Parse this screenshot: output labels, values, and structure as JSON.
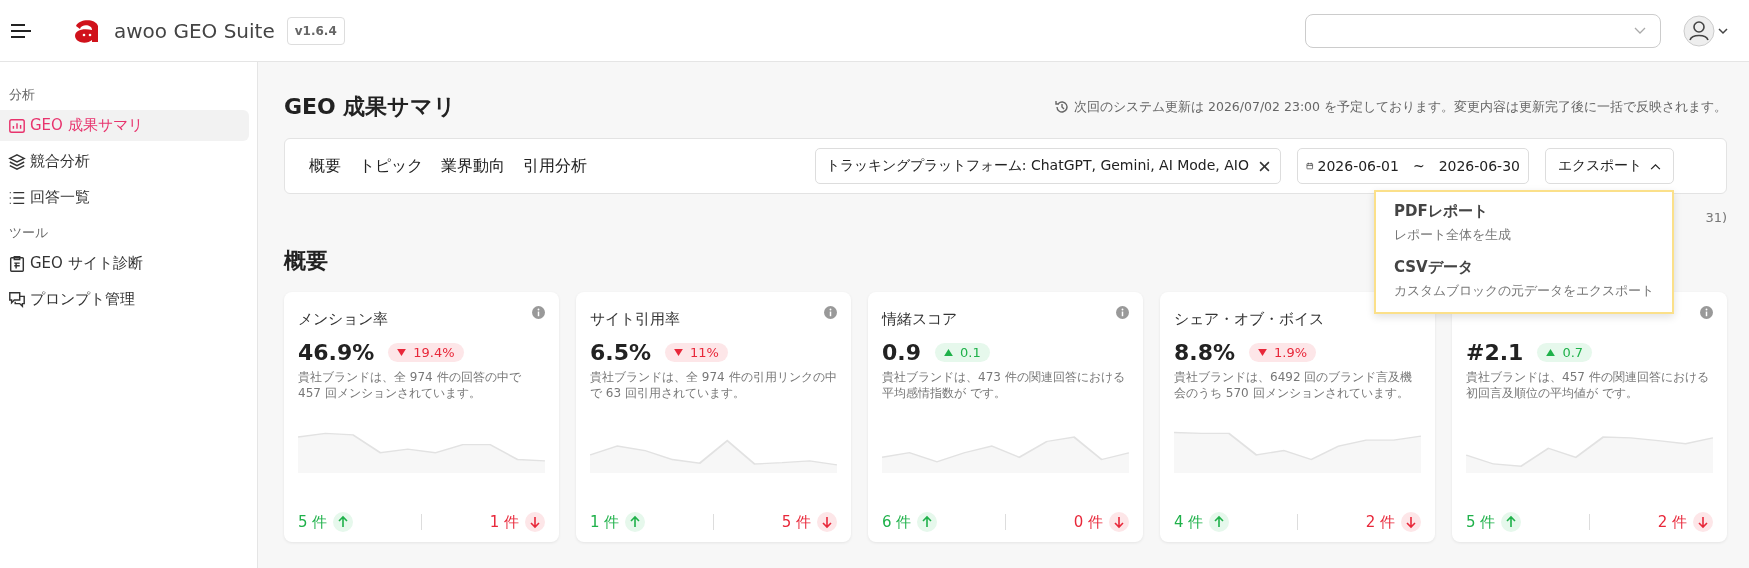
{
  "header": {
    "app_name": "awoo GEO Suite",
    "version": "v1.6.4",
    "select": {
      "open": false
    }
  },
  "sidebar": {
    "sections": [
      {
        "label": "分析",
        "items": [
          {
            "label": "GEO 成果サマリ",
            "selected": true
          },
          {
            "label": "競合分析",
            "selected": false
          },
          {
            "label": "回答一覧",
            "selected": false
          }
        ]
      },
      {
        "label": "ツール",
        "items": [
          {
            "label": "GEO サイト診断",
            "selected": false
          },
          {
            "label": "プロンプト管理",
            "selected": false
          }
        ]
      }
    ]
  },
  "page": {
    "title": "GEO 成果サマリ",
    "notice": "次回のシステム更新は 2026/07/02 23:00 を予定しております。変更内容は更新完了後に一括で反映されます。"
  },
  "tabs": [
    {
      "label": "概要"
    },
    {
      "label": "トピック"
    },
    {
      "label": "業界動向"
    },
    {
      "label": "引用分析"
    }
  ],
  "filter": {
    "value": "トラッキングプラットフォーム: ChatGPT, Gemini, AI Mode, AIO"
  },
  "date_range": {
    "start": "2026-06-01",
    "separator": "~",
    "end": "2026-06-30"
  },
  "export": {
    "label": "エクスポート",
    "expanded": true,
    "menu": [
      {
        "title": "PDFレポート",
        "description": "レポート全体を生成"
      },
      {
        "title": "CSVデータ",
        "description": "カスタムブロックの元データをエクスポート"
      }
    ]
  },
  "period_note": "31)",
  "section_title": "概要",
  "cards": [
    {
      "title": "メンション率",
      "value": "46.9%",
      "delta": "19.4%",
      "kind": "down",
      "info": true,
      "description": "貴社ブランドは、全 974 件の回答の中で 457 回メンションされています。",
      "up_count": "5 件",
      "down_count": "1 件"
    },
    {
      "title": "サイト引用率",
      "value": "6.5%",
      "delta": "11%",
      "kind": "down",
      "info": true,
      "description": "貴社ブランドは、全 974 件の引用リンクの中で 63 回引用されています。",
      "up_count": "1 件",
      "down_count": "5 件"
    },
    {
      "title": "情緒スコア",
      "value": "0.9",
      "delta": "0.1",
      "kind": "up",
      "info": true,
      "description": "貴社ブランドは、473 件の関連回答における平均感情指数が です。",
      "up_count": "6 件",
      "down_count": "0 件"
    },
    {
      "title": "シェア・オブ・ボイス",
      "value": "8.8%",
      "delta": "1.9%",
      "kind": "down",
      "info": false,
      "description": "貴社ブランドは、6492 回のブランド言及機会のうち 570 回メンションされています。",
      "up_count": "4 件",
      "down_count": "2 件"
    },
    {
      "value": "#2.1",
      "delta": "0.7",
      "kind": "up",
      "info": true,
      "description": "貴社ブランドは、457 件の関連回答における初回言及順位の平均値が です。",
      "up_count": "5 件",
      "down_count": "2 件"
    }
  ]
}
